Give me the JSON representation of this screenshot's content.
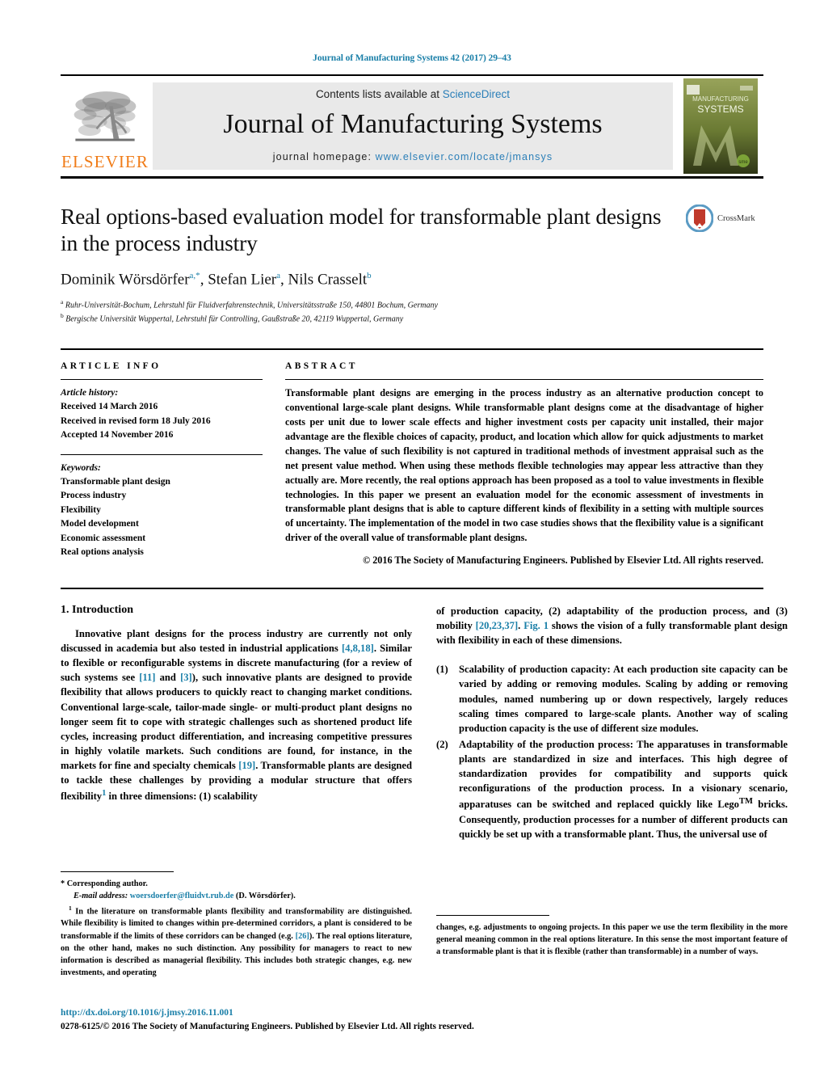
{
  "running_head": "Journal of Manufacturing Systems 42 (2017) 29–43",
  "masthead": {
    "publisher_name": "ELSEVIER",
    "contents_prefix": "Contents lists available at ",
    "contents_link": "ScienceDirect",
    "journal_title": "Journal of Manufacturing Systems",
    "homepage_label": "journal homepage: ",
    "homepage_url": "www.elsevier.com/locate/jmansys",
    "cover_title_small": "JOURNAL OF",
    "cover_title_line1": "MANUFACTURING",
    "cover_title_line2": "SYSTEMS",
    "cover_badge": "sme",
    "link_color": "#2b7fb8",
    "elsevier_orange": "#f07c18"
  },
  "article": {
    "title": "Real options-based evaluation model for transformable plant designs in the process industry",
    "authors": [
      {
        "name": "Dominik Wörsdörfer",
        "marks": "a,*"
      },
      {
        "name": "Stefan Lier",
        "marks": "a"
      },
      {
        "name": "Nils Crasselt",
        "marks": "b"
      }
    ],
    "affiliations": [
      {
        "mark": "a",
        "text": "Ruhr-Universität-Bochum, Lehrstuhl für Fluidverfahrenstechnik, Universitätsstraße 150, 44801 Bochum, Germany"
      },
      {
        "mark": "b",
        "text": "Bergische Universität Wuppertal, Lehrstuhl für Controlling, Gaußstraße 20, 42119 Wuppertal, Germany"
      }
    ],
    "crossmark_label": "CrossMark"
  },
  "article_info": {
    "heading": "ARTICLE INFO",
    "history_label": "Article history:",
    "history": [
      "Received 14 March 2016",
      "Received in revised form 18 July 2016",
      "Accepted 14 November 2016"
    ],
    "keywords_label": "Keywords:",
    "keywords": [
      "Transformable plant design",
      "Process industry",
      "Flexibility",
      "Model development",
      "Economic assessment",
      "Real options analysis"
    ]
  },
  "abstract": {
    "heading": "ABSTRACT",
    "text": "Transformable plant designs are emerging in the process industry as an alternative production concept to conventional large-scale plant designs. While transformable plant designs come at the disadvantage of higher costs per unit due to lower scale effects and higher investment costs per capacity unit installed, their major advantage are the flexible choices of capacity, product, and location which allow for quick adjustments to market changes. The value of such flexibility is not captured in traditional methods of investment appraisal such as the net present value method. When using these methods flexible technologies may appear less attractive than they actually are. More recently, the real options approach has been proposed as a tool to value investments in flexible technologies. In this paper we present an evaluation model for the economic assessment of investments in transformable plant designs that is able to capture different kinds of flexibility in a setting with multiple sources of uncertainty. The implementation of the model in two case studies shows that the flexibility value is a significant driver of the overall value of transformable plant designs.",
    "copyright": "© 2016 The Society of Manufacturing Engineers. Published by Elsevier Ltd. All rights reserved."
  },
  "body": {
    "section_number_title": "1.  Introduction",
    "left_paragraph_1_a": "Innovative plant designs for the process industry are currently not only discussed in academia but also tested in industrial applications ",
    "left_ref_1": "[4,8,18]",
    "left_paragraph_1_b": ". Similar to flexible or reconfigurable systems in discrete manufacturing (for a review of such systems see ",
    "left_ref_2": "[11]",
    "left_paragraph_1_c": " and ",
    "left_ref_3": "[3]",
    "left_paragraph_1_d": "), such innovative plants are designed to provide flexibility that allows producers to quickly react to changing market conditions. Conventional large-scale, tailor-made single- or multi-product plant designs no longer seem fit to cope with strategic challenges such as shortened product life cycles, increasing product differentiation, and increasing competitive pressures in highly volatile markets. Such conditions are found, for instance, in the markets for fine and specialty chemicals ",
    "left_ref_4": "[19]",
    "left_paragraph_1_e": ". Transformable plants are designed to tackle these challenges by providing a modular structure that offers flexibility",
    "left_footnote_mark": "1",
    "left_paragraph_1_f": " in three dimensions: (1) scalability",
    "right_paragraph_1_a": "of production capacity, (2) adaptability of the production process, and (3) mobility ",
    "right_ref_1": "[20,23,37]",
    "right_paragraph_1_b": ". ",
    "right_ref_fig": "Fig. 1",
    "right_paragraph_1_c": " shows the vision of a fully transformable plant design with flexibility in each of these dimensions.",
    "list": [
      {
        "marker": "(1)",
        "lead": "Scalability of production capacity:",
        "text": " At each production site capacity can be varied by adding or removing modules. Scaling by adding or removing modules, named numbering up or down respectively, largely reduces scaling times compared to large-scale plants. Another way of scaling production capacity is the use of different size modules."
      },
      {
        "marker": "(2)",
        "lead": "Adaptability of the production process:",
        "text": " The apparatuses in transformable plants are standardized in size and interfaces. This high degree of standardization provides for compatibility and supports quick reconfigurations of the production process. In a visionary scenario, apparatuses can be switched and replaced quickly like Lego",
        "text_sup": "TM",
        "text_after": " bricks. Consequently, production processes for a number of different products can quickly be set up with a transformable plant. Thus, the universal use of"
      }
    ]
  },
  "footnotes": {
    "corresponding_mark": "*",
    "corresponding_text": "Corresponding author.",
    "email_label": "E-mail address:",
    "email": "woersdoerfer@fluidvt.rub.de",
    "email_suffix": "(D. Wörsdörfer).",
    "note_mark": "1",
    "note_text_a": "In the literature on transformable plants flexibility and transformability are distinguished. While flexibility is limited to changes within pre-determined corridors, a plant is considered to be transformable if the limits of these corridors can be changed (e.g. ",
    "note_ref": "[26]",
    "note_text_b": "). The real options literature, on the other hand, makes no such distinction. Any possibility for managers to react to new information is described as managerial flexibility. This includes both strategic changes, e.g. new investments, and operating",
    "note_right_text": "changes, e.g. adjustments to ongoing projects. In this paper we use the term flexibility in the more general meaning common in the real options literature. In this sense the most important feature of a transformable plant is that it is flexible (rather than transformable) in a number of ways."
  },
  "doi": {
    "url": "http://dx.doi.org/10.1016/j.jmsy.2016.11.001",
    "issn_line": "0278-6125/© 2016 The Society of Manufacturing Engineers. Published by Elsevier Ltd. All rights reserved."
  }
}
